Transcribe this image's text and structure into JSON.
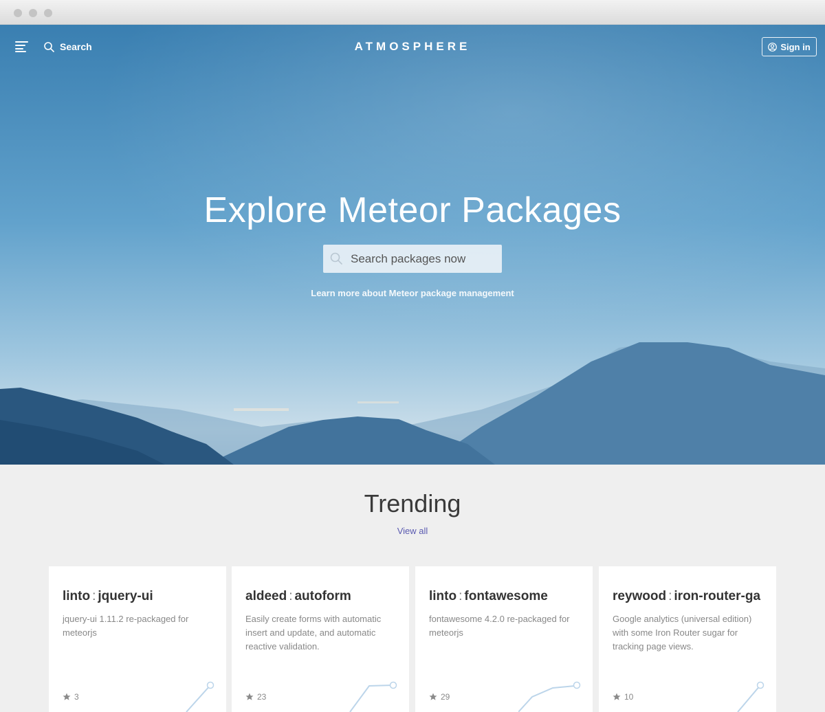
{
  "header": {
    "brand": "ATMOSPHERE",
    "search_label": "Search",
    "signin_label": "Sign in"
  },
  "hero": {
    "title": "Explore Meteor Packages",
    "search_placeholder": "Search packages now",
    "learn_more": "Learn more about Meteor package management"
  },
  "trending": {
    "title": "Trending",
    "view_all": "View all",
    "packages": [
      {
        "owner": "linto",
        "name": "jquery-ui",
        "description": "jquery-ui 1.11.2 re-packaged for meteorjs",
        "stars": "3"
      },
      {
        "owner": "aldeed",
        "name": "autoform",
        "description": "Easily create forms with automatic insert and update, and automatic reactive validation.",
        "stars": "23"
      },
      {
        "owner": "linto",
        "name": "fontawesome",
        "description": "fontawesome 4.2.0 re-packaged for meteorjs",
        "stars": "29"
      },
      {
        "owner": "reywood",
        "name": "iron-router-ga",
        "description": "Google analytics (universal edition) with some Iron Router sugar for tracking page views.",
        "stars": "10"
      }
    ]
  },
  "colors": {
    "accent_link": "#5a5ab0",
    "sparkline": "#bcd5ea"
  },
  "icons": [
    "menu-icon",
    "search-icon",
    "user-icon",
    "star-icon"
  ]
}
